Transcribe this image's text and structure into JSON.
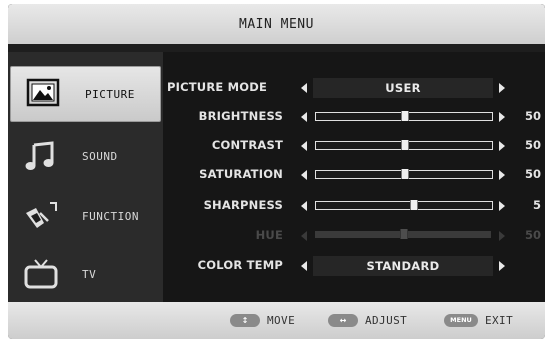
{
  "title": "MAIN MENU",
  "sidebar": {
    "items": [
      {
        "label": "PICTURE",
        "icon": "picture-icon",
        "active": true
      },
      {
        "label": "SOUND",
        "icon": "music-note-icon",
        "active": false
      },
      {
        "label": "FUNCTION",
        "icon": "function-icon",
        "active": false
      },
      {
        "label": "TV",
        "icon": "tv-icon",
        "active": false
      }
    ]
  },
  "settings": {
    "picture_mode": {
      "label": "PICTURE MODE",
      "value": "USER"
    },
    "brightness": {
      "label": "BRIGHTNESS",
      "value": "50",
      "level": 0.5
    },
    "contrast": {
      "label": "CONTRAST",
      "value": "50",
      "level": 0.5
    },
    "saturation": {
      "label": "SATURATION",
      "value": "50",
      "level": 0.5
    },
    "sharpness": {
      "label": "SHARPNESS",
      "value": "5",
      "level": 0.55
    },
    "hue": {
      "label": "HUE",
      "value": "50",
      "level": 0.5,
      "disabled": true
    },
    "color_temp": {
      "label": "COLOR TEMP",
      "value": "STANDARD"
    }
  },
  "footer": {
    "move": {
      "key": "↕",
      "label": "MOVE"
    },
    "adjust": {
      "key": "↔",
      "label": "ADJUST"
    },
    "exit": {
      "key": "MENU",
      "label": "EXIT"
    }
  },
  "colors": {
    "panel": "#1e1e1e",
    "bar": "#d9d9d9",
    "text": "#e4e4e4"
  }
}
